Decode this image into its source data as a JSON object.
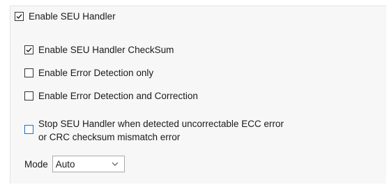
{
  "seu_handler": {
    "label": "Enable SEU Handler",
    "checked": true
  },
  "options": [
    {
      "label": "Enable SEU Handler CheckSum",
      "checked": true
    },
    {
      "label": "Enable Error Detection only",
      "checked": false
    },
    {
      "label": "Enable Error Detection and Correction",
      "checked": false
    }
  ],
  "stop_option": {
    "line1": "Stop SEU Handler when detected uncorrectable ECC error",
    "line2": "or CRC checksum mismatch error",
    "checked": false
  },
  "mode": {
    "label": "Mode",
    "value": "Auto"
  },
  "icons": {
    "check": "checkmark-icon",
    "dropdown": "chevron-down-icon"
  },
  "colors": {
    "panel_bg": "#f7f7f7",
    "checkbox_border": "#333333",
    "highlight_border": "#1f6fc4"
  }
}
